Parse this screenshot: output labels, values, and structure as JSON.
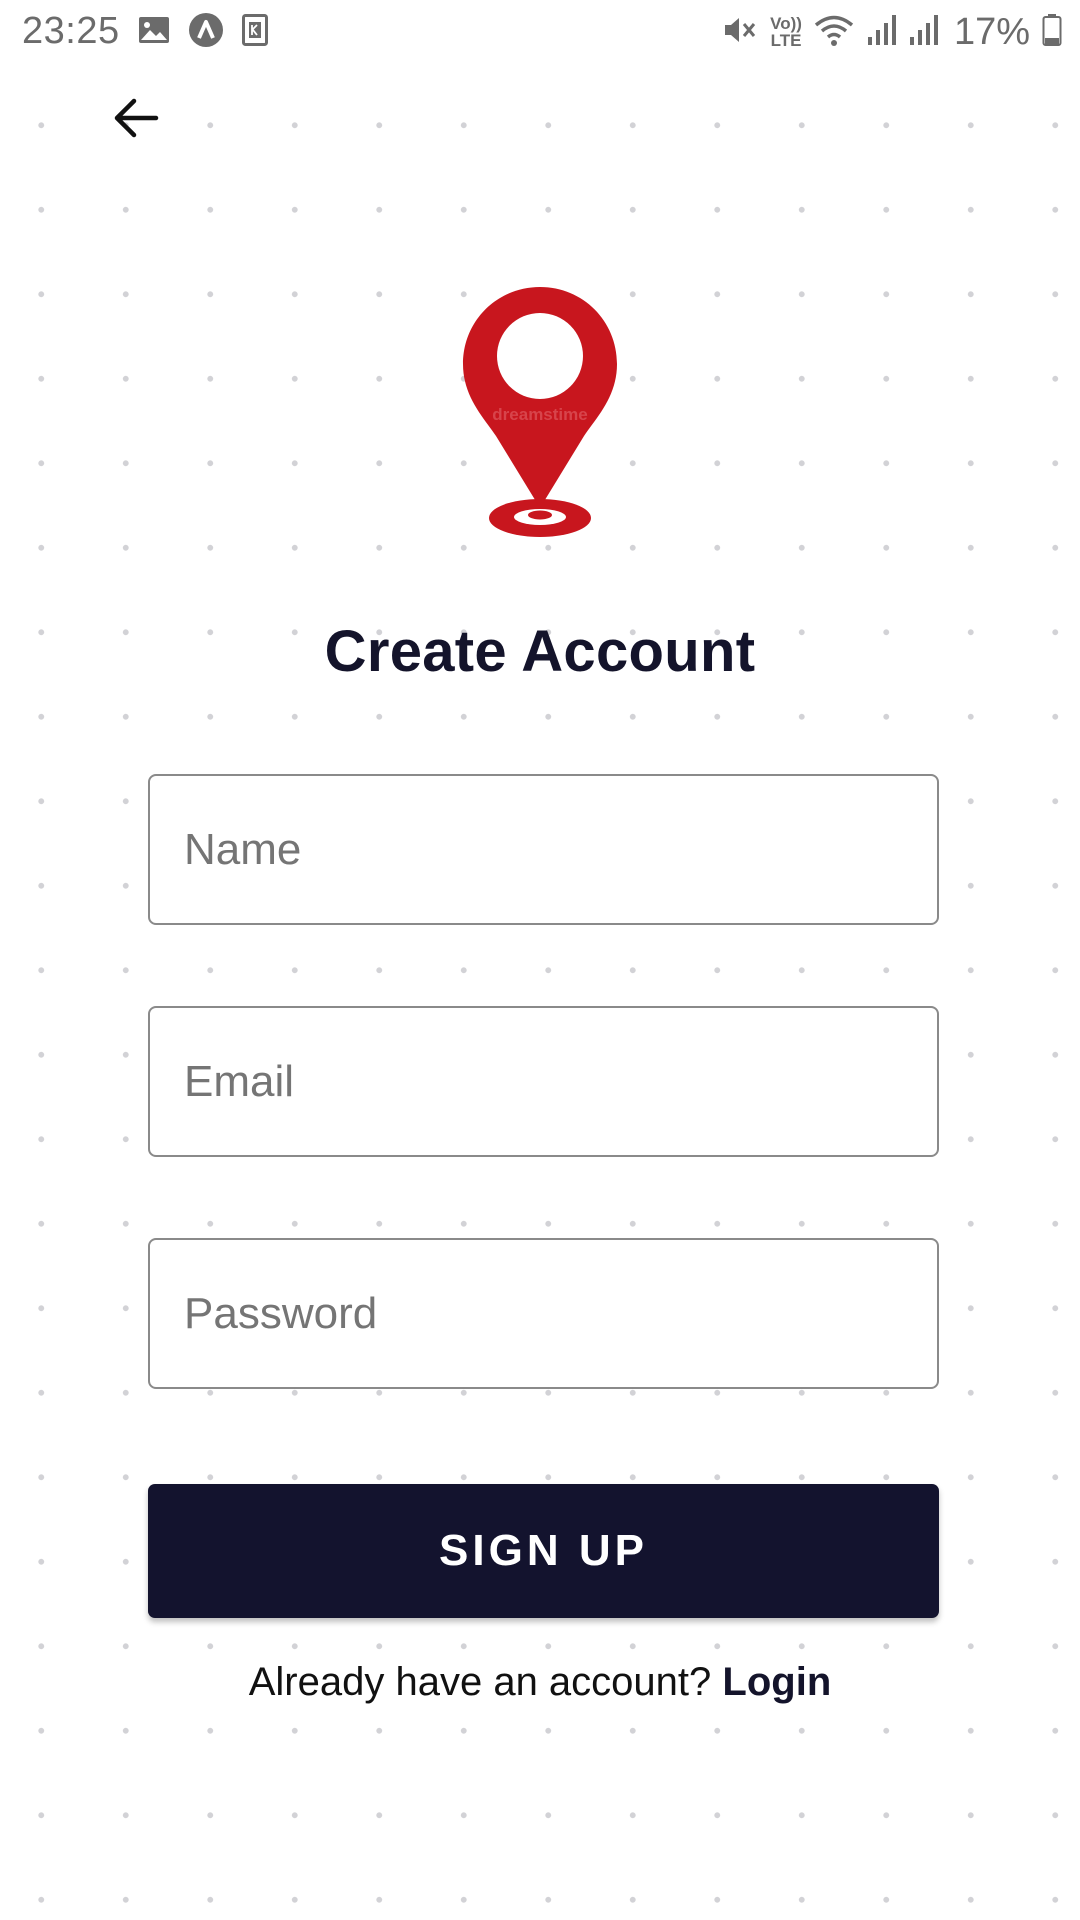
{
  "status_bar": {
    "time": "23:25",
    "battery_percent": "17%",
    "left_icons": [
      "image-icon",
      "app-a-icon",
      "k-icon"
    ],
    "right_icons": [
      "mute-icon",
      "volte-icon",
      "wifi-icon",
      "signal-icon",
      "signal-icon",
      "battery-icon"
    ],
    "volte_label_top": "Vo))",
    "volte_label_bottom": "LTE"
  },
  "header": {
    "back_icon": "arrow-left-icon"
  },
  "logo": {
    "icon": "location-pin-icon",
    "color": "#c8161e",
    "watermark_text": "dreamstime"
  },
  "title": "Create Account",
  "form": {
    "name_placeholder": "Name",
    "email_placeholder": "Email",
    "password_placeholder": "Password",
    "submit_label": "SIGN UP"
  },
  "footer": {
    "prompt": "Already have an account?",
    "login_label": "Login"
  },
  "colors": {
    "primary": "#13132e",
    "accent": "#c8161e",
    "background": "#ffffff",
    "dot_grid": "#d2d2d6"
  }
}
